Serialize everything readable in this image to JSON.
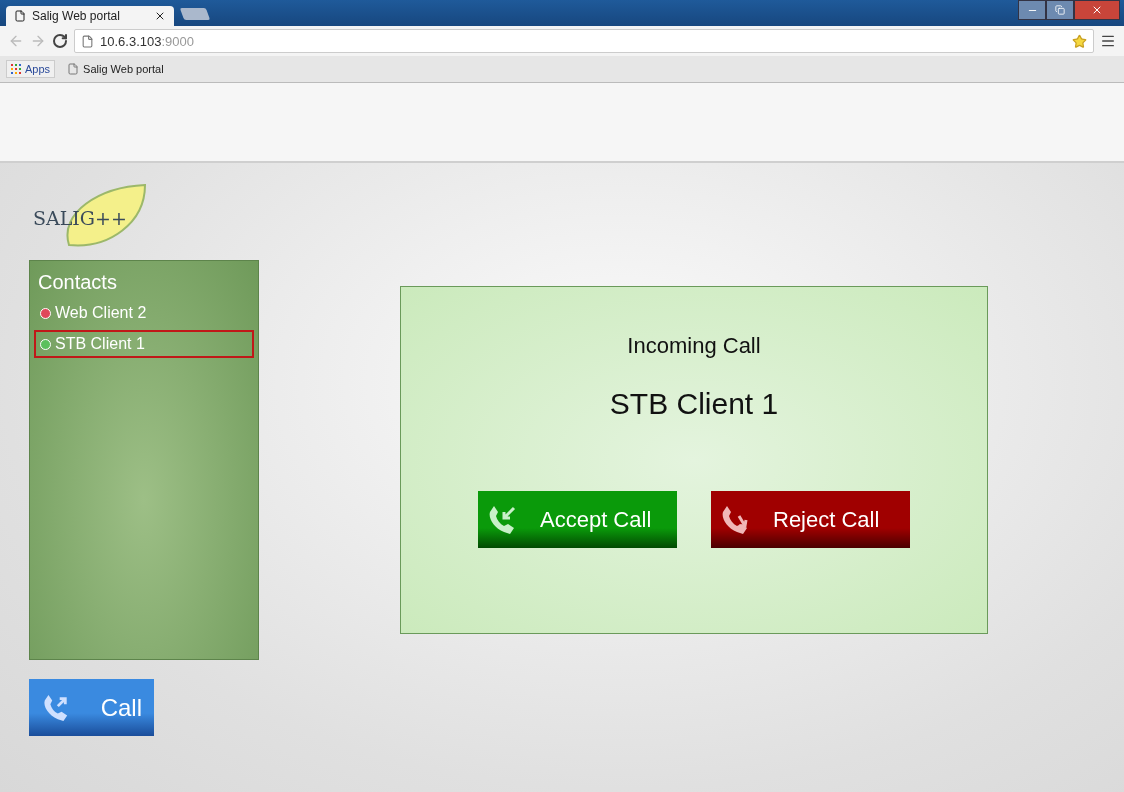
{
  "browser": {
    "tab_title": "Salig Web portal",
    "url_host": "10.6.3.103",
    "url_port": ":9000",
    "bookmarks": [
      {
        "label": "Apps",
        "kind": "apps"
      },
      {
        "label": "Salig Web portal",
        "kind": "page"
      }
    ]
  },
  "logo": {
    "text": "SALIG++"
  },
  "contacts": {
    "title": "Contacts",
    "items": [
      {
        "name": "Web Client 2",
        "color": "#e0485a",
        "selected": false
      },
      {
        "name": "STB Client 1",
        "color": "#5cc05c",
        "selected": true
      }
    ]
  },
  "call_button": "Call",
  "incoming": {
    "heading": "Incoming Call",
    "caller": "STB Client 1",
    "buttons": [
      {
        "label": "Accept Call",
        "kind": "accept"
      },
      {
        "label": "Reject Call",
        "kind": "reject"
      }
    ]
  }
}
